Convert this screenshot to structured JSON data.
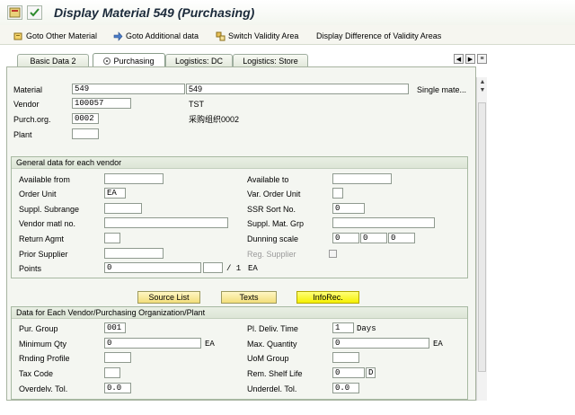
{
  "title": "Display Material 549 (Purchasing)",
  "toolbar": {
    "goto_other_material": "Goto Other Material",
    "goto_additional_data": "Goto Additional data",
    "switch_validity_area": "Switch Validity Area",
    "display_difference": "Display Difference of Validity Areas"
  },
  "tabs": [
    {
      "label": "Basic Data 2",
      "active": false
    },
    {
      "label": "Purchasing",
      "active": true
    },
    {
      "label": "Logistics: DC",
      "active": false
    },
    {
      "label": "Logistics: Store",
      "active": false
    }
  ],
  "header": {
    "material_label": "Material",
    "material_value": "549",
    "material_desc": "549",
    "material_type": "Single mate...",
    "vendor_label": "Vendor",
    "vendor_value": "100057",
    "vendor_name": "TST",
    "purch_org_label": "Purch.org.",
    "purch_org_value": "0002",
    "purch_org_name": "采购组织0002",
    "plant_label": "Plant",
    "plant_value": ""
  },
  "general": {
    "title": "General data for each vendor",
    "available_from": "Available from",
    "available_to": "Available to",
    "order_unit": "Order Unit",
    "order_unit_value": "EA",
    "var_order_unit": "Var. Order Unit",
    "suppl_subrange": "Suppl. Subrange",
    "ssr_sort_no": "SSR Sort No.",
    "ssr_sort_no_value": "0",
    "vendor_matl_no": "Vendor matl no.",
    "suppl_mat_grp": "Suppl. Mat. Grp",
    "return_agmt": "Return Agmt",
    "dunning_scale": "Dunning scale",
    "dunning_values": [
      "0",
      "0",
      "0"
    ],
    "prior_supplier": "Prior Supplier",
    "reg_supplier": "Reg. Supplier",
    "points": "Points",
    "points_value": "0",
    "points_per": "/ 1",
    "points_unit": "EA"
  },
  "buttons": {
    "source_list": "Source List",
    "texts": "Texts",
    "info_rec": "InfoRec."
  },
  "org_plant": {
    "title": "Data for Each Vendor/Purchasing Organization/Plant",
    "pur_group": "Pur. Group",
    "pur_group_value": "001",
    "pl_deliv_time": "Pl. Deliv. Time",
    "pl_deliv_time_value": "1",
    "pl_deliv_unit": "Days",
    "minimum_qty": "Minimum Qty",
    "minimum_qty_value": "0",
    "minimum_qty_unit": "EA",
    "max_quantity": "Max. Quantity",
    "max_quantity_value": "0",
    "max_quantity_unit": "EA",
    "rnding_profile": "Rnding Profile",
    "uom_group": "UoM Group",
    "tax_code": "Tax Code",
    "rem_shelf_life": "Rem. Shelf Life",
    "rem_shelf_life_value": "0",
    "rem_shelf_life_unit": "D",
    "overdelv_tol": "Overdelv. Tol.",
    "overdelv_tol_value": "0.0",
    "underdel_tol": "Underdel. Tol.",
    "underdel_tol_value": "0.0"
  }
}
